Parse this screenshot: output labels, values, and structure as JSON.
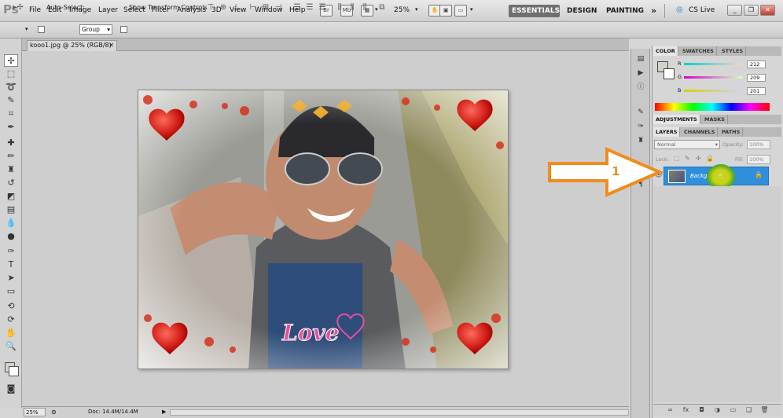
{
  "app_logo": "Ps",
  "menu": [
    "File",
    "Edit",
    "Image",
    "Layer",
    "Select",
    "Filter",
    "Analysis",
    "3D",
    "View",
    "Window",
    "Help"
  ],
  "zoom_menu": "25%",
  "workspaces": {
    "essentials": "ESSENTIALS",
    "design": "DESIGN",
    "painting": "PAINTING",
    "more": "»"
  },
  "cs_live": "CS Live",
  "options": {
    "auto_select": "Auto-Select:",
    "auto_select_value": "Group",
    "show_transform": "Show Transform Controls"
  },
  "document_tab": "kooo1.jpg @ 25% (RGB/8)",
  "status": {
    "zoom": "25%",
    "doc": "Doc: 14.4M/14.4M"
  },
  "color_panel": {
    "tabs": [
      "COLOR",
      "SWATCHES",
      "STYLES"
    ],
    "r_label": "R",
    "g_label": "G",
    "b_label": "B",
    "r": "212",
    "g": "209",
    "b": "201"
  },
  "adjust_tabs": [
    "ADJUSTMENTS",
    "MASKS"
  ],
  "layers_panel": {
    "tabs": [
      "LAYERS",
      "CHANNELS",
      "PATHS"
    ],
    "blend_mode": "Normal",
    "opacity_label": "Opacity:",
    "opacity": "100%",
    "lock_label": "Lock:",
    "fill_label": "Fill:",
    "fill": "100%",
    "layer_name": "Background"
  },
  "annotation_number": "1",
  "photo_text": "Love",
  "colors": {
    "accent": "#2f8fdd",
    "arrow": "#f08c1e",
    "workspace_active": "#6f6f6f"
  }
}
